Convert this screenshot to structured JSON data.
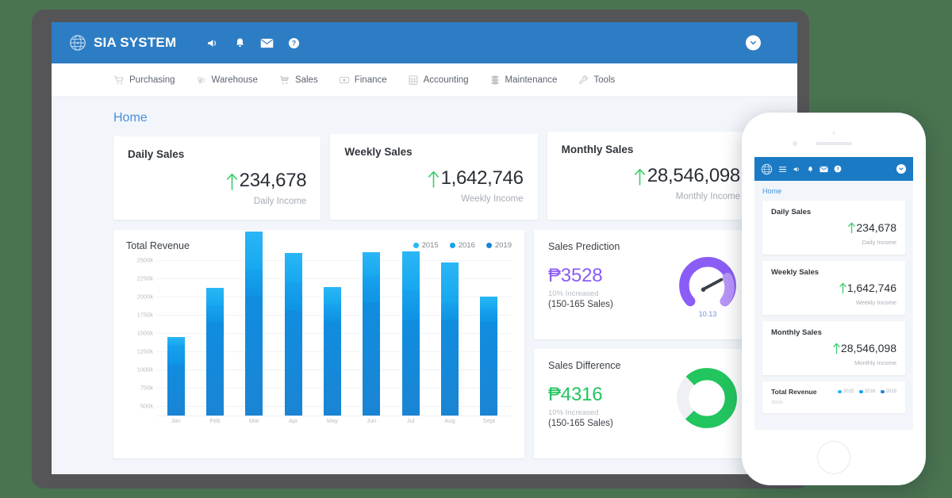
{
  "header": {
    "brand": "SIA SYSTEM",
    "icons": [
      "megaphone-icon",
      "bell-icon",
      "envelope-icon",
      "help-icon"
    ],
    "user_dropdown": "chevron-down-icon",
    "bg_color": "#2d7dc4"
  },
  "nav": {
    "items": [
      {
        "label": "Purchasing",
        "icon": "purchase-cart-icon"
      },
      {
        "label": "Warehouse",
        "icon": "warehouse-icon"
      },
      {
        "label": "Sales",
        "icon": "shopping-cart-icon"
      },
      {
        "label": "Finance",
        "icon": "money-icon"
      },
      {
        "label": "Accounting",
        "icon": "calculator-icon"
      },
      {
        "label": "Maintenance",
        "icon": "database-icon"
      },
      {
        "label": "Tools",
        "icon": "wrench-icon"
      }
    ]
  },
  "breadcrumb": "Home",
  "stats": [
    {
      "title": "Daily Sales",
      "value": "234,678",
      "sub": "Daily Income",
      "trend": "up"
    },
    {
      "title": "Weekly Sales",
      "value": "1,642,746",
      "sub": "Weekly Income",
      "trend": "up"
    },
    {
      "title": "Monthly Sales",
      "value": "28,546,098",
      "sub": "Monthly Income",
      "trend": "up"
    }
  ],
  "revenue": {
    "title": "Total Revenue",
    "legend": [
      {
        "label": "2015",
        "color": "#2ab6f6"
      },
      {
        "label": "2016",
        "color": "#17a2ee"
      },
      {
        "label": "2019",
        "color": "#1b84d4"
      }
    ]
  },
  "cards": {
    "prediction": {
      "title": "Sales Prediction",
      "amount": "₱3528",
      "increase": "10% Increased",
      "range": "(150-165 Sales)",
      "gauge_value": "10.13",
      "color": "#8b5cf6"
    },
    "difference": {
      "title": "Sales Difference",
      "amount": "₱4316",
      "increase": "10% Increased",
      "range": "(150-165 Sales)",
      "donut_percent": 75,
      "color": "#22c55e"
    }
  },
  "phone": {
    "brand_icon": "globe-icon",
    "menu_icon": "hamburger-icon",
    "breadcrumb": "Home",
    "stats": [
      {
        "title": "Daily Sales",
        "value": "234,678",
        "sub": "Daily Income"
      },
      {
        "title": "Weekly Sales",
        "value": "1,642,746",
        "sub": "Weekly Income"
      },
      {
        "title": "Monthly Sales",
        "value": "28,546,098",
        "sub": "Monthly Income"
      }
    ],
    "revenue_title": "Total Revenue",
    "revenue_ylab": "2500k"
  },
  "chart_data": {
    "type": "bar",
    "title": "Total Revenue",
    "xlabel": "",
    "ylabel": "",
    "ylim": [
      375,
      2500
    ],
    "grid": true,
    "legend_position": "top-right",
    "stacked": true,
    "categories": [
      "Jan",
      "Feb",
      "Mar",
      "Apr",
      "May",
      "Jun",
      "Jul",
      "Aug",
      "Sept"
    ],
    "ticks": [
      "2500k",
      "2250k",
      "2000k",
      "1750k",
      "1500k",
      "1250k",
      "1000k",
      "750k",
      "500k"
    ],
    "series": [
      {
        "name": "2019",
        "color": "#1b84d4",
        "values": [
          690,
          1260,
          1630,
          1430,
          1290,
          1530,
          1300,
          1300,
          1270
        ]
      },
      {
        "name": "2016",
        "color": "#17a2ee",
        "values": [
          265,
          240,
          360,
          390,
          220,
          370,
          420,
          230,
          190
        ]
      },
      {
        "name": "2015",
        "color": "#2ab6f6",
        "values": [
          115,
          240,
          520,
          400,
          240,
          330,
          520,
          560,
          160
        ]
      }
    ],
    "totals": [
      1070,
      1740,
      2510,
      2220,
      1750,
      2230,
      2240,
      2090,
      1620
    ]
  }
}
